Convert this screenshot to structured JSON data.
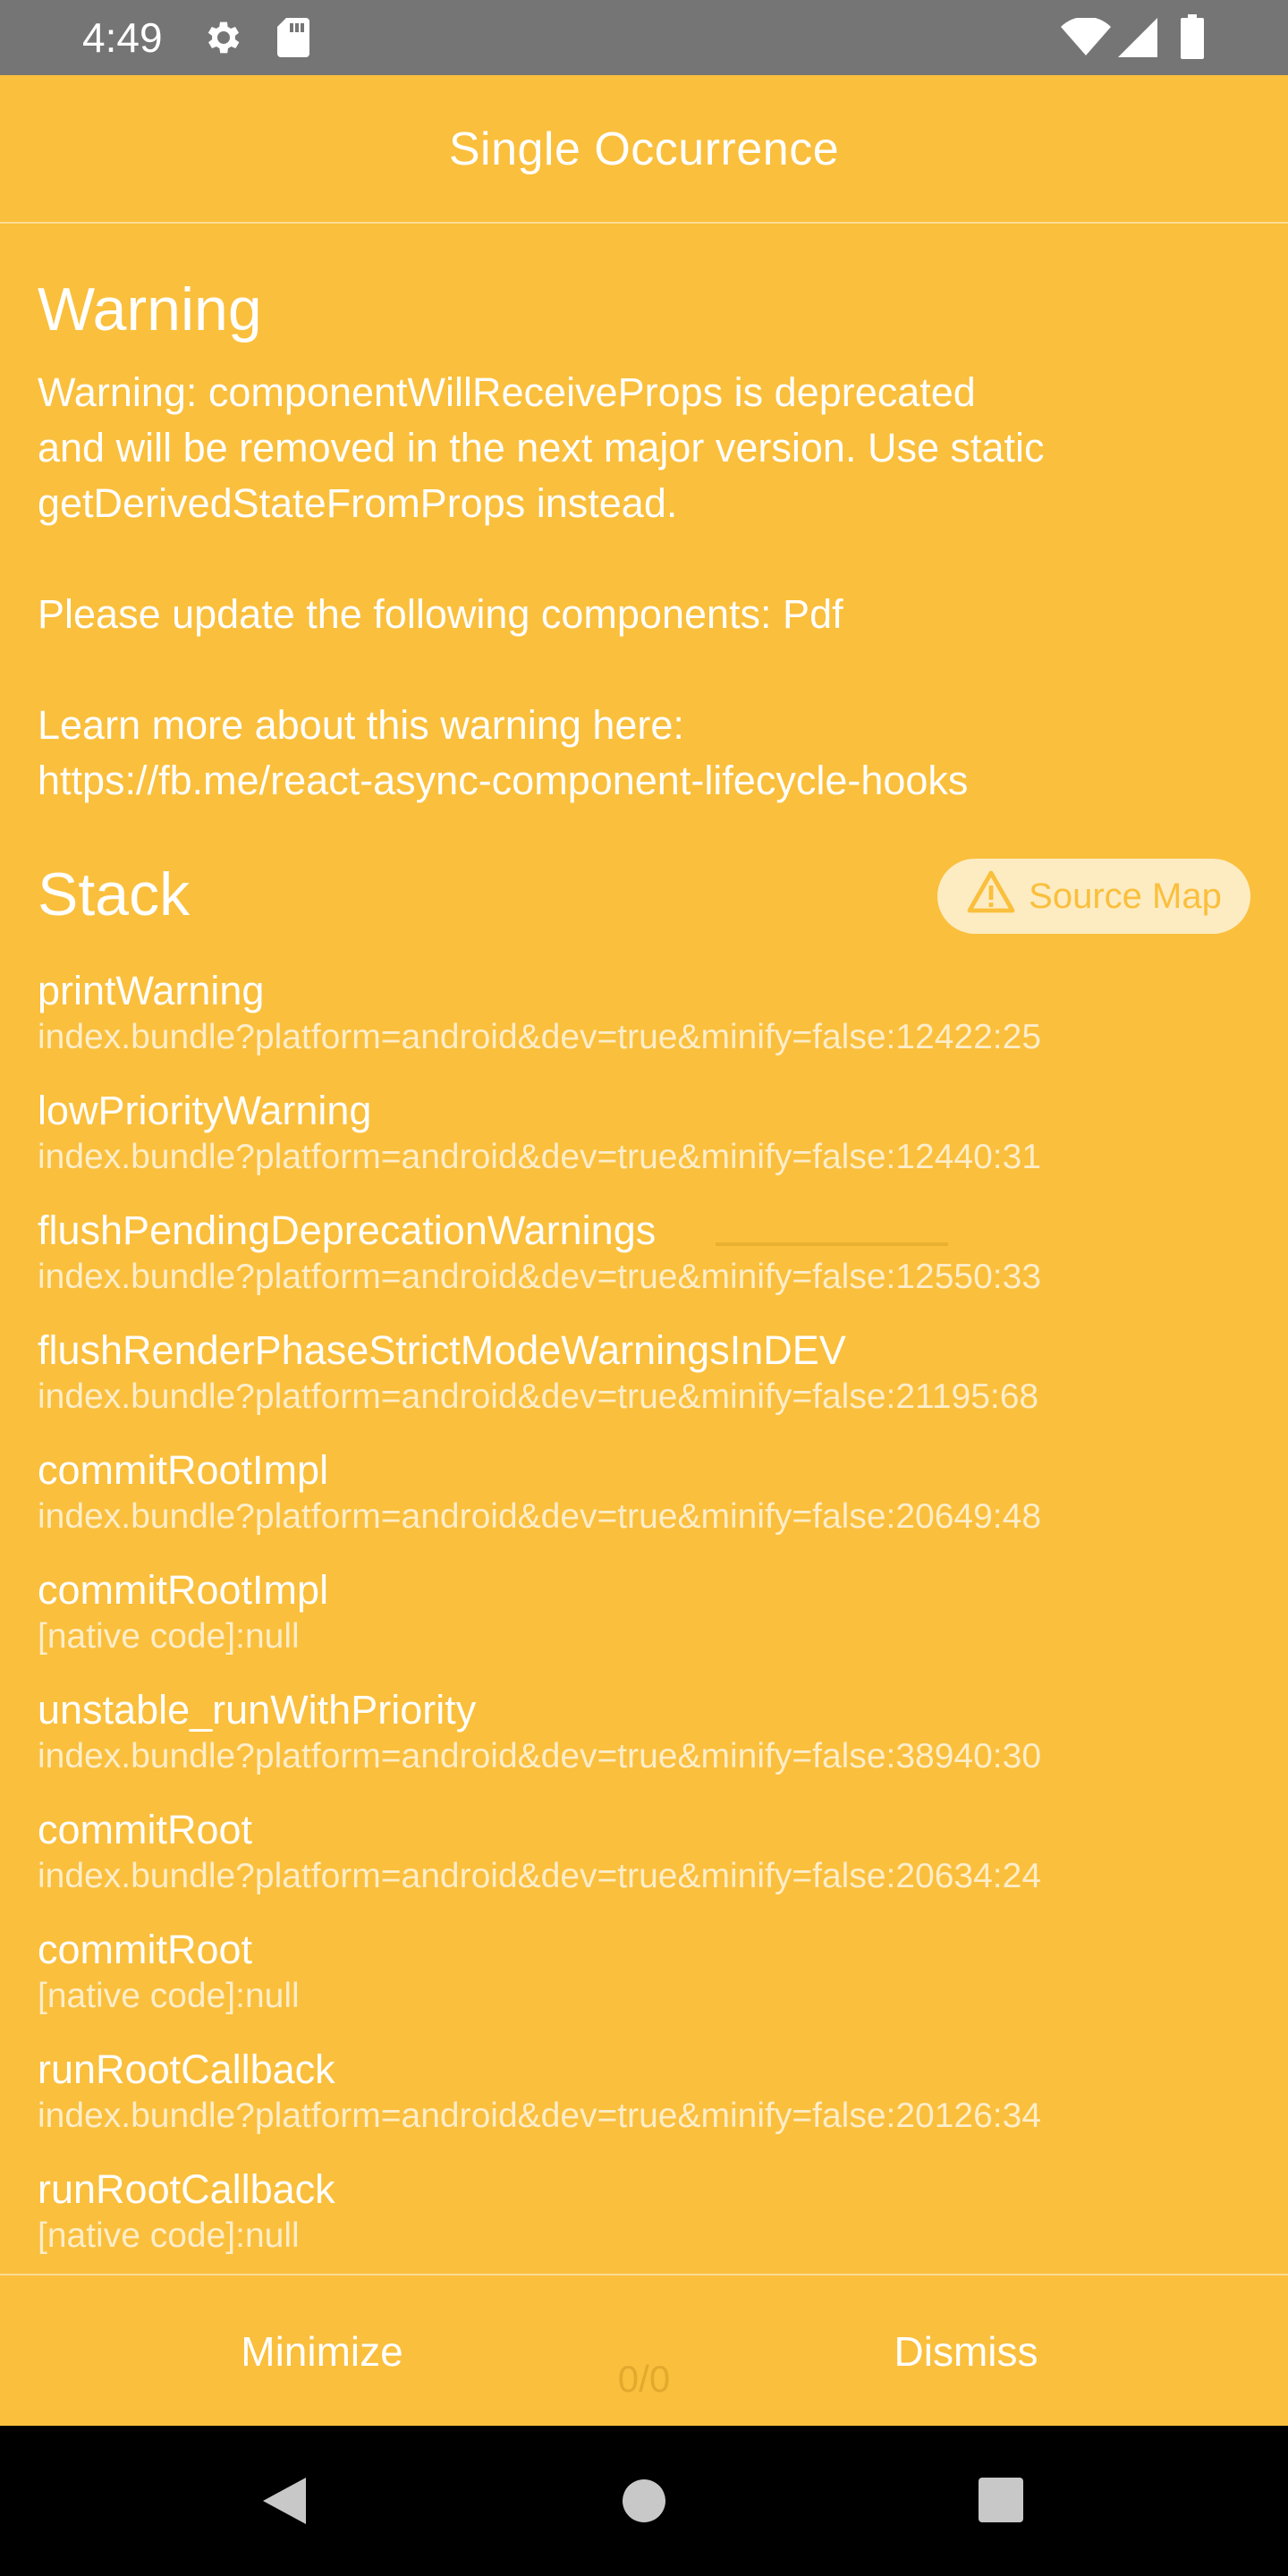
{
  "status_bar": {
    "time": "4:49",
    "icons": [
      "gear-icon",
      "sd-card-icon",
      "wifi-icon",
      "signal-icon",
      "battery-icon"
    ]
  },
  "header": {
    "title": "Single Occurrence"
  },
  "warning": {
    "heading": "Warning",
    "message": "Warning: componentWillReceiveProps is deprecated\nand will be removed in the next major version. Use static\ngetDerivedStateFromProps instead.\n\nPlease update the following components: Pdf\n\nLearn more about this warning here:\nhttps://fb.me/react-async-component-lifecycle-hooks"
  },
  "stack": {
    "heading": "Stack",
    "source_map_label": "Source Map",
    "frames": [
      {
        "name": "printWarning",
        "location": "index.bundle?platform=android&dev=true&minify=false:12422:25"
      },
      {
        "name": "lowPriorityWarning",
        "location": "index.bundle?platform=android&dev=true&minify=false:12440:31"
      },
      {
        "name": "flushPendingDeprecationWarnings",
        "location": "index.bundle?platform=android&dev=true&minify=false:12550:33"
      },
      {
        "name": "flushRenderPhaseStrictModeWarningsInDEV",
        "location": "index.bundle?platform=android&dev=true&minify=false:21195:68"
      },
      {
        "name": "commitRootImpl",
        "location": "index.bundle?platform=android&dev=true&minify=false:20649:48"
      },
      {
        "name": "commitRootImpl",
        "location": "[native code]:null"
      },
      {
        "name": "unstable_runWithPriority",
        "location": "index.bundle?platform=android&dev=true&minify=false:38940:30"
      },
      {
        "name": "commitRoot",
        "location": "index.bundle?platform=android&dev=true&minify=false:20634:24"
      },
      {
        "name": "commitRoot",
        "location": "[native code]:null"
      },
      {
        "name": "runRootCallback",
        "location": "index.bundle?platform=android&dev=true&minify=false:20126:34"
      },
      {
        "name": "runRootCallback",
        "location": "[native code]:null"
      }
    ]
  },
  "footer": {
    "minimize_label": "Minimize",
    "dismiss_label": "Dismiss",
    "pager": "0/0"
  },
  "colors": {
    "background": "#fabf3c",
    "status_bar": "#757575",
    "nav_bar": "#000000",
    "source_map_pill": "#fdecc2"
  }
}
